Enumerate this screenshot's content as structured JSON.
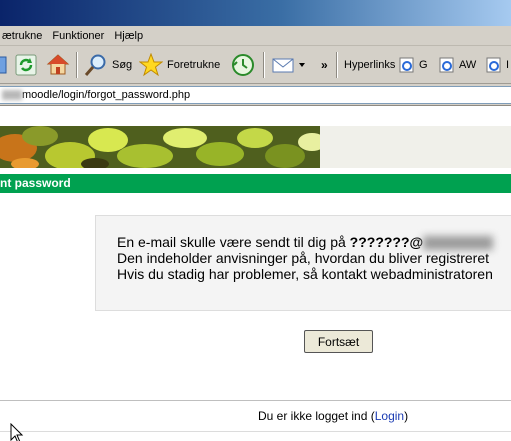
{
  "menu": [
    "ætrukne",
    "Funktioner",
    "Hjælp"
  ],
  "toolbar": {
    "search_label": "Søg",
    "favorites_label": "Foretrukne",
    "overflow": "»",
    "links_label": "Hyperlinks",
    "link1": "G",
    "link2": "AW",
    "link3": "I"
  },
  "address": {
    "url": "moodle/login/forgot_password.php"
  },
  "page": {
    "nav_title": "nt password",
    "message_line1_prefix": "En e-mail skulle være sendt til dig på ",
    "message_line1_mail": "???????@",
    "message_line2": "Den indeholder anvisninger på, hvordan du bliver registreret",
    "message_line3": "Hvis du stadig har problemer, så kontakt webadministratoren",
    "continue_button": "Fortsæt",
    "footer_prefix": "Du er ikke logget ind (",
    "footer_login": "Login",
    "footer_suffix": ")"
  }
}
